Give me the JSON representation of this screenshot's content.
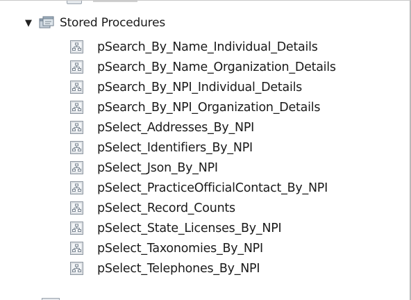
{
  "tree": {
    "folder": {
      "label": "Stored Procedures",
      "expanded": true,
      "expander_glyph": "▼",
      "icon": "stored-procedures-folder-icon"
    },
    "procedures": [
      {
        "label": "pSearch_By_Name_Individual_Details",
        "icon": "stored-procedure-icon"
      },
      {
        "label": "pSearch_By_Name_Organization_Details",
        "icon": "stored-procedure-icon"
      },
      {
        "label": "pSearch_By_NPI_Individual_Details",
        "icon": "stored-procedure-icon"
      },
      {
        "label": "pSearch_By_NPI_Organization_Details",
        "icon": "stored-procedure-icon"
      },
      {
        "label": "pSelect_Addresses_By_NPI",
        "icon": "stored-procedure-icon"
      },
      {
        "label": "pSelect_Identifiers_By_NPI",
        "icon": "stored-procedure-icon"
      },
      {
        "label": "pSelect_Json_By_NPI",
        "icon": "stored-procedure-icon"
      },
      {
        "label": "pSelect_PracticeOfficialContact_By_NPI",
        "icon": "stored-procedure-icon"
      },
      {
        "label": "pSelect_Record_Counts",
        "icon": "stored-procedure-icon"
      },
      {
        "label": "pSelect_State_Licenses_By_NPI",
        "icon": "stored-procedure-icon"
      },
      {
        "label": "pSelect_Taxonomies_By_NPI",
        "icon": "stored-procedure-icon"
      },
      {
        "label": "pSelect_Telephones_By_NPI",
        "icon": "stored-procedure-icon"
      }
    ]
  },
  "colors": {
    "icon_fill": "#e9ecef",
    "icon_border": "#8d96a0",
    "icon_glyph": "#7a8591",
    "folder_fill": "#c9d3dd",
    "folder_border": "#6f7e8c",
    "text": "#1a1a1a",
    "background": "#ffffff"
  }
}
